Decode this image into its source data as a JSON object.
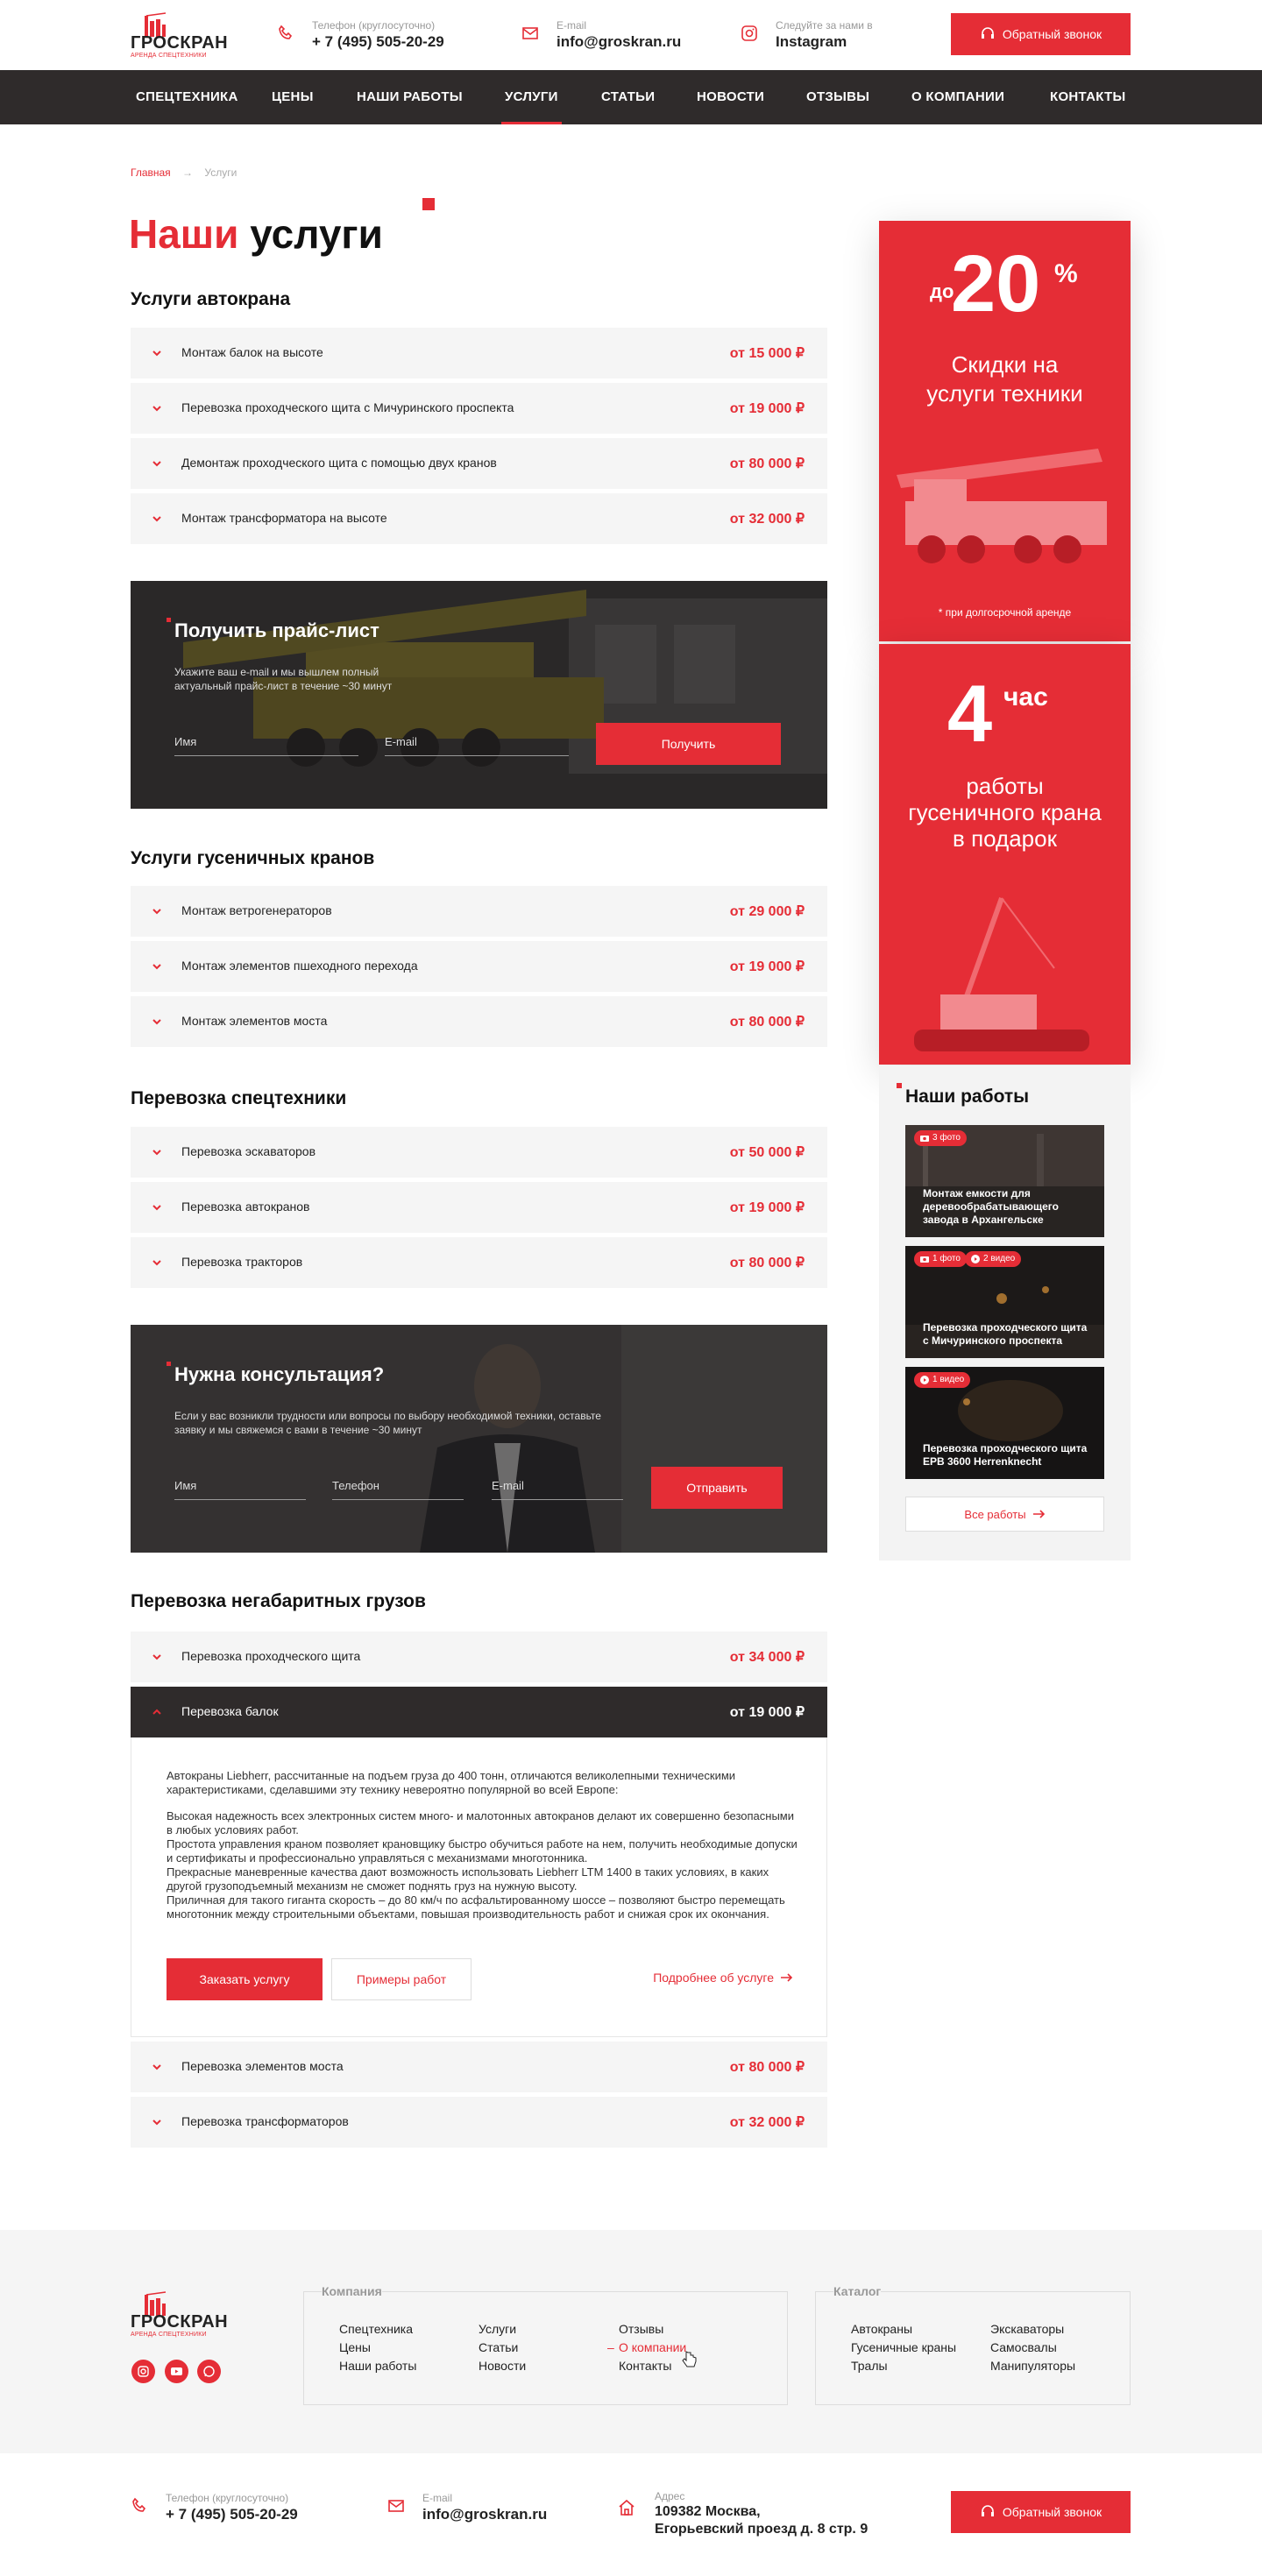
{
  "brand": {
    "name": "ГРОСКРАН",
    "tagline": "АРЕНДА СПЕЦТЕХНИКИ"
  },
  "header": {
    "phone_label": "Телефон (круглосуточно)",
    "phone": "+ 7 (495) 505-20-29",
    "email_label": "E-mail",
    "email": "info@groskran.ru",
    "insta_label": "Следуйте за нами в",
    "insta": "Instagram",
    "callback": "Обратный звонок"
  },
  "nav": [
    "СПЕЦТЕХНИКА",
    "ЦЕНЫ",
    "НАШИ РАБОТЫ",
    "УСЛУГИ",
    "СТАТЬИ",
    "НОВОСТИ",
    "ОТЗЫВЫ",
    "О КОМПАНИИ",
    "КОНТАКТЫ"
  ],
  "breadcrumb": {
    "home": "Главная",
    "current": "Услуги"
  },
  "title": {
    "accent": "Наши",
    "rest": "услуги"
  },
  "sections": [
    {
      "title": "Услуги автокрана",
      "items": [
        {
          "name": "Монтаж балок на высоте",
          "price": "от 15 000 ₽"
        },
        {
          "name": "Перевозка проходческого щита с Мичуринского проспекта",
          "price": "от 19 000 ₽"
        },
        {
          "name": "Демонтаж проходческого щита с помощью двух кранов",
          "price": "от 80 000 ₽"
        },
        {
          "name": "Монтаж трансформатора на высоте",
          "price": "от 32 000 ₽"
        }
      ]
    },
    {
      "title": "Услуги гусеничных кранов",
      "items": [
        {
          "name": "Монтаж ветрогенераторов",
          "price": "от 29 000 ₽"
        },
        {
          "name": "Монтаж элементов пшеходного перехода",
          "price": "от 19 000 ₽"
        },
        {
          "name": "Монтаж элементов моста",
          "price": "от 80 000 ₽"
        }
      ]
    },
    {
      "title": "Перевозка спецтехники",
      "items": [
        {
          "name": "Перевозка эскаваторов",
          "price": "от 50 000 ₽"
        },
        {
          "name": "Перевозка автокранов",
          "price": "от 19 000 ₽"
        },
        {
          "name": "Перевозка тракторов",
          "price": "от 80 000 ₽"
        }
      ]
    },
    {
      "title": "Перевозка негабаритных грузов",
      "items": [
        {
          "name": "Перевозка проходческого щита",
          "price": "от 34 000 ₽"
        },
        {
          "name": "Перевозка балок",
          "price": "от 19 000 ₽"
        },
        {
          "name": "Перевозка элементов моста",
          "price": "от 80 000 ₽"
        },
        {
          "name": "Перевозка трансформаторов",
          "price": "от 32 000 ₽"
        }
      ]
    }
  ],
  "detail": {
    "p1": "Автокраны Liebherr, рассчитанные на подъем груза до 400 тонн, отличаются великолепными техническими характеристиками, сделавшими эту технику невероятно популярной во всей Европе:",
    "p2": "Высокая надежность всех электронных систем много- и малотонных автокранов делают их совершенно безопасными в любых условиях работ.",
    "p3": "Простота управления краном позволяет крановщику быстро обучиться работе на нем, получить необходимые допуски и сертификаты и профессионально управляться с механизмами многотонника.",
    "p4": "Прекрасные маневренные качества дают возможность использовать Liebherr LTM 1400 в таких условиях, в каких другой грузоподъемный механизм не сможет поднять груз на нужную высоту.",
    "p5": "Приличная для такого гиганта скорость – до 80 км/ч по асфальтированному шоссе – позволяют быстро перемещать многотонник между строительными объектами, повышая производительность работ и снижая срок их окончания.",
    "order": "Заказать услугу",
    "examples": "Примеры работ",
    "more": "Подробнее об услуге"
  },
  "pricelist_form": {
    "title": "Получить прайс-лист",
    "desc": "Укажите ваш e-mail и мы вышлем полный актуальный прайс-лист в течение ~30 минут",
    "name_ph": "Имя",
    "email_ph": "E-mail",
    "submit": "Получить"
  },
  "consult_form": {
    "title": "Нужна консультация?",
    "desc": "Если у вас возникли трудности или вопросы по выбору необходимой техники, оставьте заявку и мы свяжемся с вами в течение ~30 минут",
    "name_ph": "Имя",
    "phone_ph": "Телефон",
    "email_ph": "E-mail",
    "submit": "Отправить"
  },
  "promo1": {
    "prefix": "до",
    "number": "20",
    "suffix": "%",
    "text": "Скидки на услуги техники",
    "note": "* при долгосрочной аренде"
  },
  "promo2": {
    "number": "4",
    "suffix": "час",
    "text": "работы гусеничного крана в подарок"
  },
  "works": {
    "title": "Наши работы",
    "cards": [
      {
        "badges": [
          "3 фото"
        ],
        "caption": "Монтаж емкости для деревообрабатывающего завода в Архангельске"
      },
      {
        "badges": [
          "1 фото",
          "2 видео"
        ],
        "caption": "Перевозка проходческого щита с Мичуринского проспекта"
      },
      {
        "badges": [
          "1 видео"
        ],
        "caption": "Перевозка проходческого щита EPB 3600 Herrenknecht"
      }
    ],
    "all": "Все работы"
  },
  "footer": {
    "company_title": "Компания",
    "company_links": [
      "Спецтехника",
      "Цены",
      "Наши работы",
      "Услуги",
      "Статьи",
      "Новости",
      "Отзывы",
      "О компании",
      "Контакты"
    ],
    "catalog_title": "Каталог",
    "catalog_links": [
      "Автокраны",
      "Гусеничные краны",
      "Тралы",
      "Экскаваторы",
      "Самосвалы",
      "Манипуляторы"
    ],
    "phone_label": "Телефон (круглосуточно)",
    "phone": "+ 7 (495) 505-20-29",
    "email_label": "E-mail",
    "email": "info@groskran.ru",
    "address_label": "Адрес",
    "address1": "109382 Москва,",
    "address2": "Егорьевский проезд д. 8 стр. 9",
    "callback": "Обратный звонок"
  },
  "colors": {
    "accent": "#e52d36",
    "dark": "#2f2b2b"
  }
}
